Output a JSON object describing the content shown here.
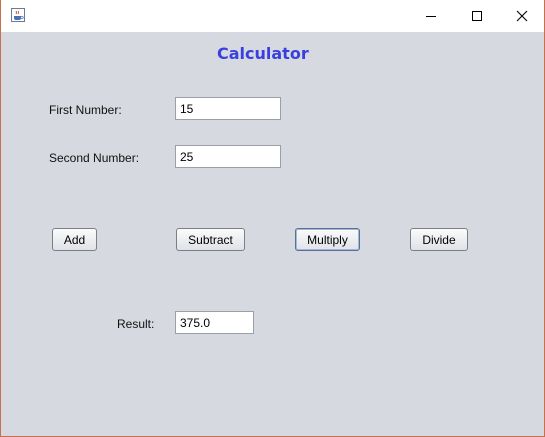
{
  "window": {
    "title": "",
    "icon": "java-cup-icon",
    "controls": [
      "minimize-icon",
      "maximize-icon",
      "close-icon"
    ]
  },
  "form": {
    "heading": "Calculator",
    "first_label": "First Number:",
    "first_value": "15",
    "second_label": "Second Number:",
    "second_value": "25",
    "result_label": "Result:",
    "result_value": "375.0"
  },
  "buttons": {
    "add": "Add",
    "subtract": "Subtract",
    "multiply": "Multiply",
    "divide": "Divide"
  },
  "colors": {
    "heading": "#3b3fe0",
    "background": "#d6d9e0"
  }
}
